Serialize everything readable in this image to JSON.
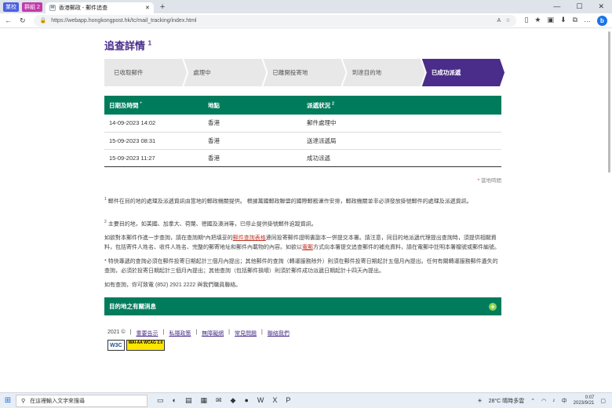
{
  "browser": {
    "btn1": "業校",
    "btn2": "群組 2",
    "tab_title": "香港郵政 - 郵件追查",
    "url": "https://webapp.hongkongpost.hk/tc/mail_tracking/index.html"
  },
  "page": {
    "title": "追查詳情",
    "title_sup": "1",
    "steps": [
      "已收取郵件",
      "處理中",
      "已離開投寄地",
      "到達目的地",
      "已成功派遞"
    ],
    "active_step": 4,
    "table": {
      "headers": [
        "日期及時間",
        "地點",
        "派遞狀況"
      ],
      "header_sups": [
        "*",
        "",
        "2"
      ],
      "rows": [
        [
          "14-09-2023 14:02",
          "香港",
          "郵件處理中"
        ],
        [
          "15-09-2023 08:31",
          "香港",
          "送達派遞局"
        ],
        [
          "15-09-2023 11:27",
          "香港",
          "成功派遞"
        ]
      ]
    },
    "note_star": "*",
    "note": "當地時間",
    "p1_sup": "1",
    "p1": "郵件在目的地的處理及派遞資訊由當地的郵政機關提供。 根據萬國郵政聯盟的國際郵務運作安排，郵政機關並非必須發放掛號郵件的處理及派遞資訊。",
    "p2_sup": "2",
    "p2": "主要目的地，如美國、加拿大、荷蘭、德國及澳洲等，已停止提供掛號郵件追蹤資訊。",
    "p3_a": "如欲對本郵件作進一步查詢，請在查詢期*內把填妥的",
    "p3_link1": "郵件查詢表格",
    "p3_b": "連同投寄郵件證明書副本一併提交本署。請注意，同目的地派遞代理提出查詢時，須提供相關資料，包括寄件人姓名、收件人姓名、完整的郵寄地址和郵件內載物的內容。如欲以",
    "p3_link2": "電郵",
    "p3_c": "方式向本署提交追查郵件的補充資料，請在電郵中註明本署檔號或郵件編號。",
    "p4": "* 特快專遞的查詢必須在郵件投寄日期起計三個月內提出；其他郵件的查詢（轉運服務除外）則須在郵件投寄日期起計五個月內提出。任何有關轉運服務郵件遺失的查詢，必須於投寄日期起計三個月內提出；其他查詢（包括郵件損壞）則須於郵件成功派遞日期起計十四天內提出。",
    "p5": "如有查詢，你可致電 (852) 2921 2222 與我們職員聯絡。",
    "accordion": "目的地之有關消息",
    "footer_year": "2021 ©",
    "footer_links": [
      "重要告示",
      "私隱政策",
      "無障礙網",
      "常見問題",
      "聯絡我們"
    ],
    "badge_w3c": "W3C",
    "badge_wai": "WAI-AA WCAG 2.0"
  },
  "taskbar": {
    "search_placeholder": "在這裡輸入文字來搜尋",
    "weather": "28°C 晴時多雲",
    "ime": "中",
    "time": "0:07",
    "date": "2023/9/21"
  }
}
